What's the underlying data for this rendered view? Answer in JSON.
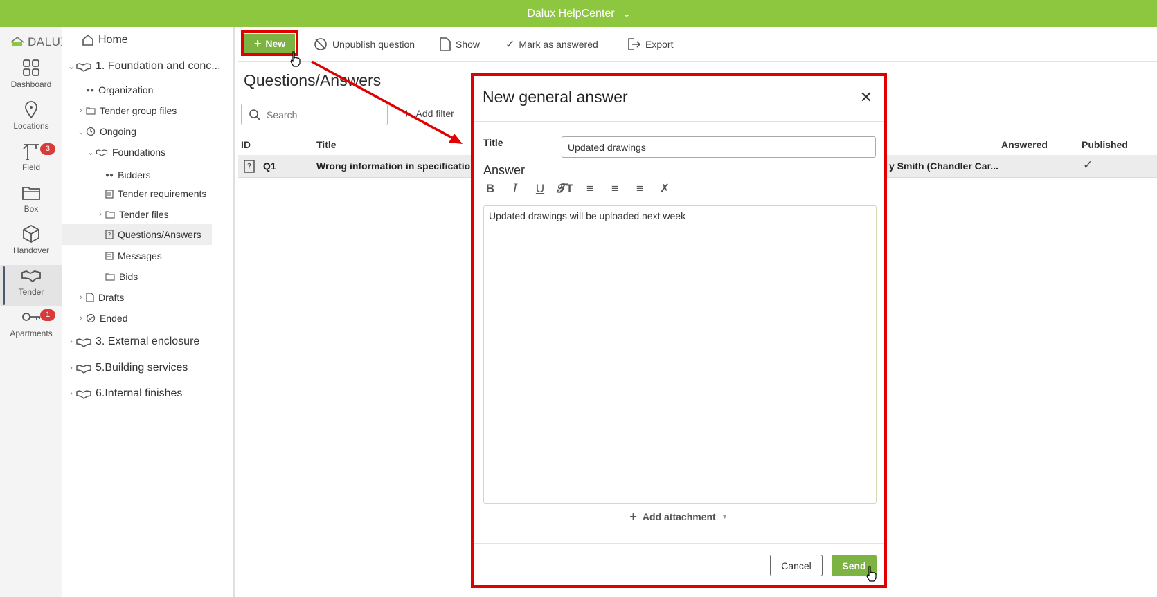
{
  "topbar": {
    "title": "Dalux HelpCenter"
  },
  "rail": {
    "logo_text": "DALUX",
    "items": [
      {
        "label": "Dashboard",
        "icon": "grid-icon"
      },
      {
        "label": "Locations",
        "icon": "pin-icon"
      },
      {
        "label": "Field",
        "icon": "crane-icon",
        "badge": "3"
      },
      {
        "label": "Box",
        "icon": "folder-icon"
      },
      {
        "label": "Handover",
        "icon": "cube-icon"
      },
      {
        "label": "Tender",
        "icon": "handshake-icon"
      },
      {
        "label": "Apartments",
        "icon": "key-icon",
        "badge": "1"
      }
    ]
  },
  "tree": {
    "home": "Home",
    "project1": "1. Foundation and conc...",
    "organization": "Organization",
    "tender_group_files": "Tender group files",
    "ongoing": "Ongoing",
    "foundations": "Foundations",
    "bidders": "Bidders",
    "tender_requirements": "Tender requirements",
    "tender_files": "Tender files",
    "questions_answers": "Questions/Answers",
    "messages": "Messages",
    "bids": "Bids",
    "drafts": "Drafts",
    "ended": "Ended",
    "project3": "3. External enclosure",
    "project5": "5.Building services",
    "project6": "6.Internal finishes"
  },
  "toolbar": {
    "new": "New",
    "unpublish": "Unpublish question",
    "show": "Show",
    "mark_answered": "Mark as answered",
    "export": "Export"
  },
  "main": {
    "heading": "Questions/Answers",
    "search_placeholder": "Search",
    "add_filter": "Add filter",
    "columns": {
      "id": "ID",
      "title": "Title",
      "answered": "Answered",
      "published": "Published"
    },
    "row": {
      "id": "Q1",
      "title": "Wrong information in specification",
      "asker": "y Smith (Chandler Car..."
    }
  },
  "dialog": {
    "title": "New general answer",
    "title_label": "Title",
    "title_value": "Updated drawings",
    "answer_label": "Answer",
    "answer_text": "Updated drawings will be uploaded next week",
    "add_attachment": "Add attachment",
    "cancel": "Cancel",
    "send": "Send"
  },
  "colors": {
    "brand": "#8dc63f",
    "button": "#7cb342",
    "highlight": "#e00000",
    "badge": "#d83b3b"
  }
}
